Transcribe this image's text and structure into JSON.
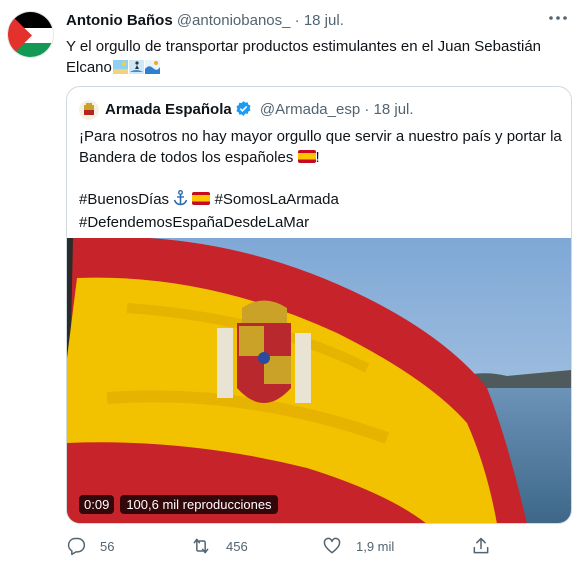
{
  "tweet": {
    "author_name": "Antonio Baños",
    "author_handle": "@antoniobanos_",
    "separator": "·",
    "date": "18 jul.",
    "text_line1": "Y el orgullo de transportar productos estimulantes en el Juan Sebastián",
    "text_line2": "Elcano",
    "emoji_names": [
      "beach-icon",
      "surfer-icon",
      "wave-icon"
    ]
  },
  "quoted": {
    "author_name": "Armada Española",
    "author_handle": "@Armada_esp",
    "separator": "·",
    "date": "18 jul.",
    "line1": "¡Para nosotros no hay mayor orgullo que servir a nuestro país y portar la",
    "line2_pre": "Bandera de todos los españoles",
    "line2_post": "!",
    "hashtag1": "#BuenosDías",
    "hashtag2": "#SomosLaArmada",
    "hashtag3": "#DefendemosEspañaDesdeLaMar",
    "video_time": "0:09",
    "video_views": "100,6 mil reproducciones"
  },
  "actions": {
    "replies": "56",
    "retweets": "456",
    "likes": "1,9 mil"
  },
  "colors": {
    "text": "#0f1419",
    "secondary": "#536471",
    "verified": "#1d9bf0",
    "border": "#cfd9de",
    "flag_red": "#c60b1e",
    "flag_yellow": "#ffc400"
  }
}
